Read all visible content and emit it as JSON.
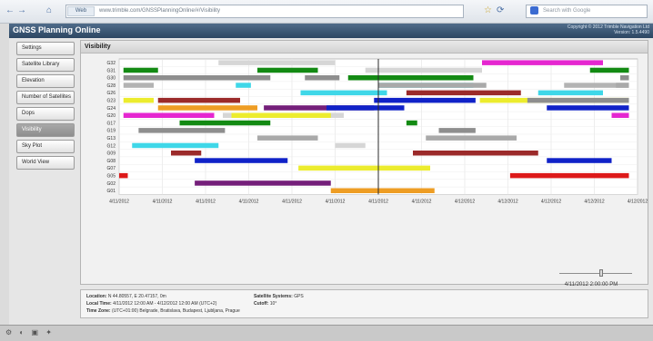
{
  "browser": {
    "back": "←",
    "forward": "→",
    "home": "⌂",
    "url": "www.trimble.com/GNSSPlanningOnline/#/Visibility",
    "site_badge": "Web",
    "search_placeholder": "Search with Google",
    "star": "☆",
    "refresh": "⟳"
  },
  "app": {
    "title": "GNSS Planning Online",
    "copyright_line1": "Copyright © 2012 Trimble Navigation Ltd",
    "copyright_line2": "Version: 1.5.4490"
  },
  "sidebar": {
    "items": [
      {
        "label": "Settings"
      },
      {
        "label": "Satellite Library"
      },
      {
        "label": "Elevation"
      },
      {
        "label": "Number of Satellites"
      },
      {
        "label": "Dops"
      },
      {
        "label": "Visibility"
      },
      {
        "label": "Sky Plot"
      },
      {
        "label": "World View"
      }
    ],
    "active_index": 5
  },
  "panel": {
    "title": "Visibility"
  },
  "chart_data": {
    "type": "gantt",
    "x_tick_labels": [
      "4/11/2012",
      "4/11/2012",
      "4/11/2012",
      "4/11/2012",
      "4/11/2012",
      "4/11/2012",
      "4/11/2012",
      "4/11/2012",
      "4/12/2012",
      "4/12/2012",
      "4/12/2012",
      "4/12/2012",
      "4/12/2012"
    ],
    "xlim": [
      0,
      24
    ],
    "cursor_hour": 12,
    "satellites": [
      "G32",
      "G31",
      "G30",
      "G28",
      "G26",
      "G23",
      "G24",
      "G20",
      "G17",
      "G19",
      "G13",
      "G12",
      "G09",
      "G08",
      "G07",
      "G05",
      "G02",
      "G01"
    ],
    "bars": [
      {
        "sat": 0,
        "start": 4.6,
        "end": 10.0,
        "color": "#d6d6d6"
      },
      {
        "sat": 1,
        "start": 0.2,
        "end": 1.8,
        "color": "#138a13"
      },
      {
        "sat": 1,
        "start": 6.4,
        "end": 9.2,
        "color": "#138a13"
      },
      {
        "sat": 1,
        "start": 21.8,
        "end": 23.6,
        "color": "#138a13"
      },
      {
        "sat": 2,
        "start": 0.2,
        "end": 3.8,
        "color": "#8e8e8e"
      },
      {
        "sat": 2,
        "start": 8.6,
        "end": 10.2,
        "color": "#8e8e8e"
      },
      {
        "sat": 2,
        "start": 23.2,
        "end": 23.6,
        "color": "#8e8e8e"
      },
      {
        "sat": 3,
        "start": 5.4,
        "end": 6.1,
        "color": "#3fd7e8"
      },
      {
        "sat": 3,
        "start": 12.0,
        "end": 16.4,
        "color": "#3fd7e8"
      },
      {
        "sat": 3,
        "start": 20.6,
        "end": 23.6,
        "color": "#b3b3b3"
      },
      {
        "sat": 4,
        "start": 13.3,
        "end": 18.6,
        "color": "#9b2a2a"
      },
      {
        "sat": 5,
        "start": 0.2,
        "end": 1.6,
        "color": "#ecec2e"
      },
      {
        "sat": 5,
        "start": 11.8,
        "end": 16.5,
        "color": "#1022c8"
      },
      {
        "sat": 5,
        "start": 16.7,
        "end": 23.6,
        "color": "#ecec2e"
      },
      {
        "sat": 6,
        "start": 1.8,
        "end": 6.4,
        "color": "#ee9d24"
      },
      {
        "sat": 6,
        "start": 6.7,
        "end": 11.8,
        "color": "#741f7a"
      },
      {
        "sat": 7,
        "start": 0.2,
        "end": 4.4,
        "color": "#e526d0"
      },
      {
        "sat": 7,
        "start": 4.8,
        "end": 10.4,
        "color": "#d6d6d6"
      },
      {
        "sat": 7,
        "start": 22.8,
        "end": 23.6,
        "color": "#e526d0"
      },
      {
        "sat": 8,
        "start": 2.8,
        "end": 7.0,
        "color": "#138a13"
      },
      {
        "sat": 8,
        "start": 13.3,
        "end": 13.8,
        "color": "#138a13"
      },
      {
        "sat": 9,
        "start": 0.9,
        "end": 4.9,
        "color": "#8e8e8e"
      },
      {
        "sat": 9,
        "start": 14.8,
        "end": 16.5,
        "color": "#8e8e8e"
      },
      {
        "sat": 10,
        "start": 6.4,
        "end": 9.2,
        "color": "#a9a9a9"
      },
      {
        "sat": 10,
        "start": 14.2,
        "end": 18.4,
        "color": "#a9a9a9"
      },
      {
        "sat": 11,
        "start": 0.6,
        "end": 4.6,
        "color": "#3fd7e8"
      },
      {
        "sat": 11,
        "start": 10.0,
        "end": 11.4,
        "color": "#d6d6d6"
      },
      {
        "sat": 12,
        "start": 2.4,
        "end": 3.8,
        "color": "#9b2a2a"
      },
      {
        "sat": 12,
        "start": 13.6,
        "end": 19.4,
        "color": "#9b2a2a"
      },
      {
        "sat": 13,
        "start": 3.5,
        "end": 7.8,
        "color": "#1022c8"
      },
      {
        "sat": 13,
        "start": 19.8,
        "end": 22.8,
        "color": "#1022c8"
      },
      {
        "sat": 14,
        "start": 8.3,
        "end": 14.4,
        "color": "#ecec2e"
      },
      {
        "sat": 15,
        "start": 0.0,
        "end": 0.4,
        "color": "#dd1a1a"
      },
      {
        "sat": 15,
        "start": 18.1,
        "end": 23.6,
        "color": "#dd1a1a"
      },
      {
        "sat": 16,
        "start": 3.5,
        "end": 9.8,
        "color": "#741f7a"
      },
      {
        "sat": 17,
        "start": 9.8,
        "end": 14.6,
        "color": "#ee9d24"
      },
      {
        "sat": 18,
        "start": 16.8,
        "end": 22.4,
        "color": "#e526d0"
      },
      {
        "sat": 19,
        "start": 11.4,
        "end": 16.8,
        "color": "#d6d6d6"
      },
      {
        "sat": 20,
        "start": 1.2,
        "end": 7.0,
        "color": "#8e8e8e"
      },
      {
        "sat": 20,
        "start": 10.6,
        "end": 16.4,
        "color": "#138a13"
      },
      {
        "sat": 21,
        "start": 0.2,
        "end": 1.6,
        "color": "#b3b3b3"
      },
      {
        "sat": 21,
        "start": 12.0,
        "end": 17.0,
        "color": "#a9a9a9"
      },
      {
        "sat": 21,
        "start": 23.0,
        "end": 23.6,
        "color": "#a9a9a9"
      },
      {
        "sat": 22,
        "start": 8.4,
        "end": 12.4,
        "color": "#3fd7e8"
      },
      {
        "sat": 22,
        "start": 19.4,
        "end": 22.4,
        "color": "#3fd7e8"
      },
      {
        "sat": 23,
        "start": 1.8,
        "end": 5.6,
        "color": "#9b2a2a"
      },
      {
        "sat": 23,
        "start": 18.9,
        "end": 23.6,
        "color": "#8e8e8e"
      },
      {
        "sat": 24,
        "start": 9.6,
        "end": 13.2,
        "color": "#1022c8"
      },
      {
        "sat": 24,
        "start": 19.8,
        "end": 23.6,
        "color": "#1022c8"
      },
      {
        "sat": 25,
        "start": 5.2,
        "end": 9.8,
        "color": "#ecec2e"
      }
    ]
  },
  "time_control": {
    "readout": "4/11/2012 2:00:00 PM",
    "value_fraction": 0.58
  },
  "info": {
    "location_key": "Location:",
    "location_val": "N 44.80557, E 20.47157, 0m",
    "satellite_systems_key": "Satellite Systems:",
    "satellite_systems_val": "GPS",
    "local_time_key": "Local Time:",
    "local_time_val": "4/11/2012 12:00 AM - 4/12/2012 12:00 AM (UTC+2)",
    "cutoff_key": "Cutoff:",
    "cutoff_val": "10°",
    "time_zone_key": "Time Zone:",
    "time_zone_val": "(UTC+01:00) Belgrade, Bratislava, Budapest, Ljubljana, Prague"
  },
  "status_bar": {
    "icons": "⚙ ◐ ▣ ✦"
  }
}
